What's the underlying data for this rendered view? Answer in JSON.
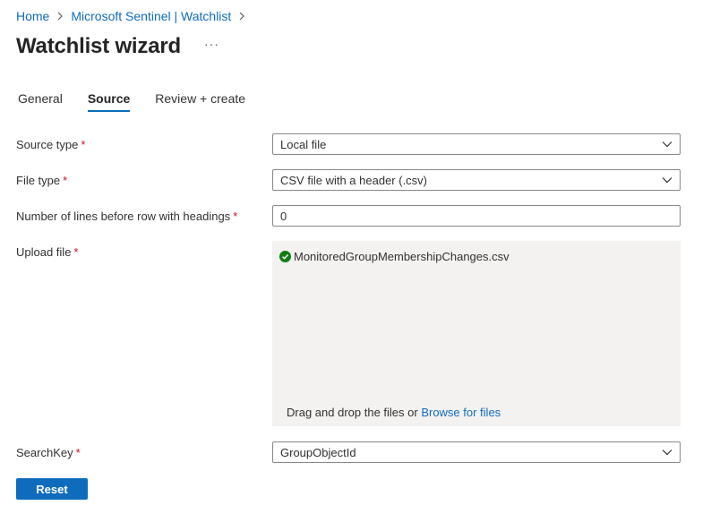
{
  "breadcrumb": {
    "items": [
      "Home",
      "Microsoft Sentinel | Watchlist"
    ]
  },
  "header": {
    "title": "Watchlist wizard",
    "more_label": "···"
  },
  "tabs": [
    {
      "label": "General",
      "active": false
    },
    {
      "label": "Source",
      "active": true
    },
    {
      "label": "Review + create",
      "active": false
    }
  ],
  "form": {
    "source_type": {
      "label": "Source type",
      "value": "Local file"
    },
    "file_type": {
      "label": "File type",
      "value": "CSV file with a header (.csv)"
    },
    "lines_before": {
      "label": "Number of lines before row with headings",
      "value": "0"
    },
    "upload": {
      "label": "Upload file",
      "file_name": "MonitoredGroupMembershipChanges.csv",
      "drop_text": "Drag and drop the files or ",
      "browse_label": "Browse for files"
    },
    "search_key": {
      "label": "SearchKey",
      "value": "GroupObjectId"
    },
    "required_marker": "*"
  },
  "actions": {
    "reset_label": "Reset"
  },
  "colors": {
    "accent": "#0f6cbd",
    "required": "#c50f1f",
    "success": "#107c10",
    "upload_bg": "#f3f2f1"
  }
}
